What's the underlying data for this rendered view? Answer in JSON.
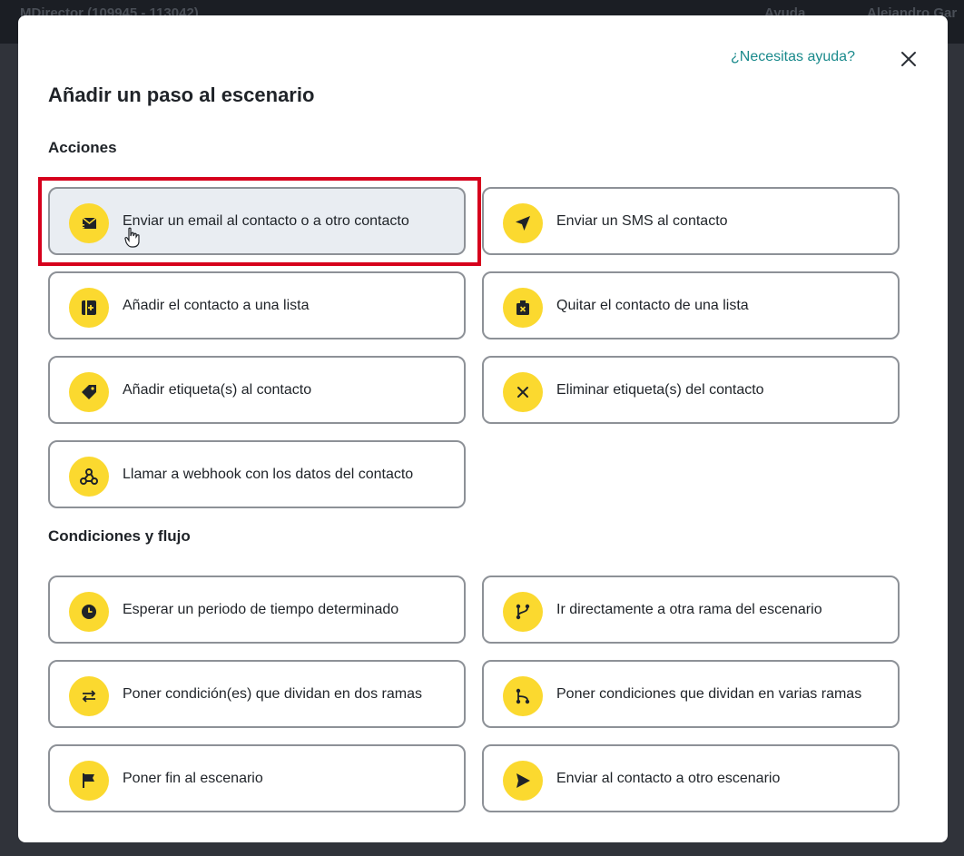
{
  "background": {
    "app_name": "MDirector (109945 - 113042)",
    "help_menu": "Ayuda",
    "user_name": "Alejandro Gar"
  },
  "modal": {
    "help_link": "¿Necesitas ayuda?",
    "title": "Añadir un paso al escenario",
    "sections": [
      {
        "title": "Acciones",
        "options": [
          {
            "label": "Enviar un email al contacto o a otro contacto",
            "icon": "email-send-icon",
            "hovered": true
          },
          {
            "label": "Enviar un SMS al contacto",
            "icon": "send-arrow-icon"
          },
          {
            "label": "Añadir el contacto a una lista",
            "icon": "list-add-icon"
          },
          {
            "label": "Quitar el contacto de una lista",
            "icon": "list-remove-icon"
          },
          {
            "label": "Añadir etiqueta(s) al contacto",
            "icon": "tag-icon"
          },
          {
            "label": "Eliminar etiqueta(s) del contacto",
            "icon": "x-icon"
          },
          {
            "label": "Llamar a webhook con los datos del contacto",
            "icon": "webhook-icon"
          }
        ]
      },
      {
        "title": "Condiciones y flujo",
        "options": [
          {
            "label": "Esperar un periodo de tiempo determinado",
            "icon": "clock-icon"
          },
          {
            "label": "Ir directamente a otra rama del escenario",
            "icon": "branch-icon"
          },
          {
            "label": "Poner condición(es) que dividan en dos ramas",
            "icon": "swap-arrows-icon"
          },
          {
            "label": "Poner condiciones que dividan en varias ramas",
            "icon": "multi-branch-icon"
          },
          {
            "label": "Poner fin al escenario",
            "icon": "flag-icon"
          },
          {
            "label": "Enviar al contacto a otro escenario",
            "icon": "play-send-icon"
          }
        ]
      }
    ]
  },
  "colors": {
    "accent_yellow": "#fbd92f",
    "link_teal": "#1a8a8c",
    "highlight_red": "#d6001c",
    "hover_bg": "#e9edf2"
  }
}
